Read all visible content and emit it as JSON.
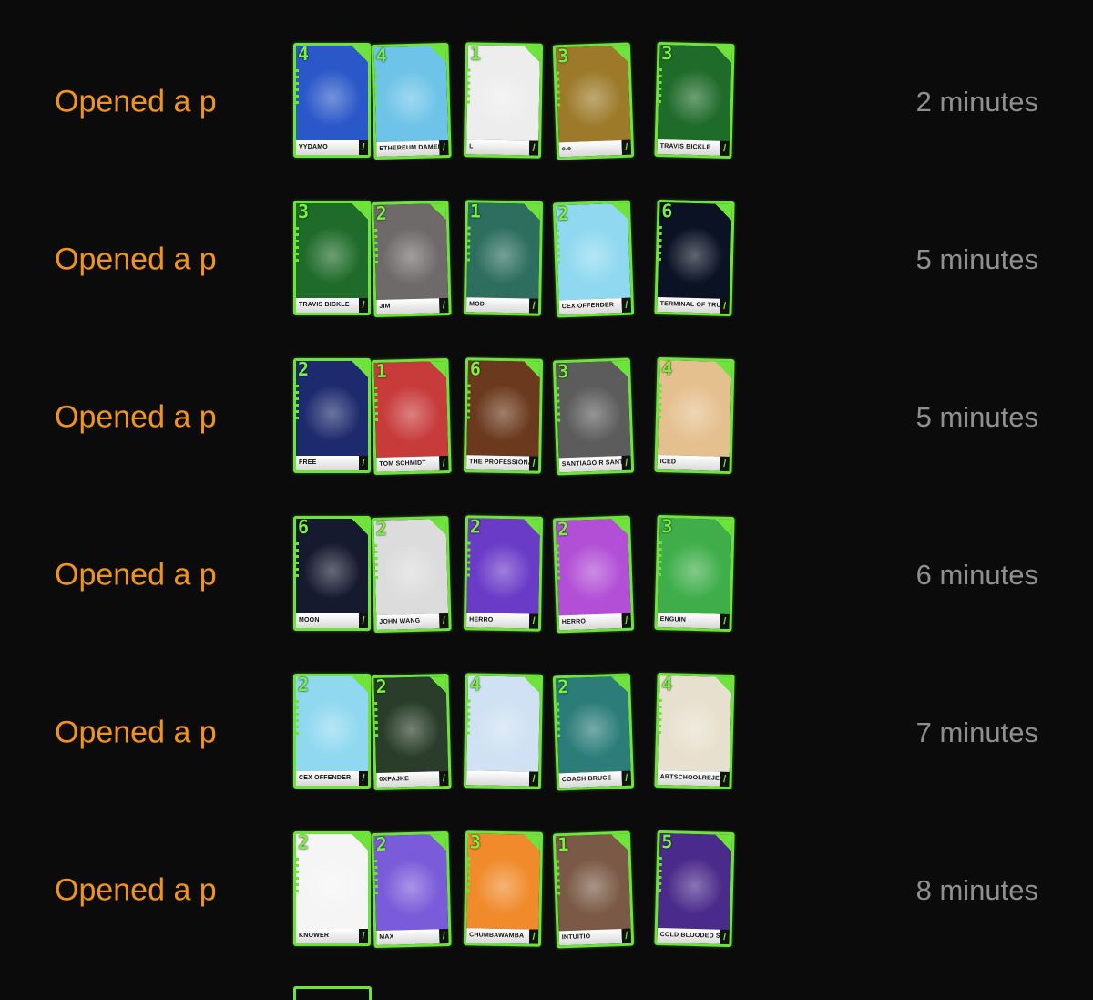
{
  "colors": {
    "action": "#f0941f",
    "time": "#8f8f8f",
    "card_border": "#6ee33c",
    "background": "#0b0b0b"
  },
  "feed": [
    {
      "action": "Opened a p",
      "time": "2 minutes",
      "cards": [
        {
          "rank": "4",
          "name": "VYDAMO",
          "palette": "#2b58c9"
        },
        {
          "rank": "4",
          "name": "ETHEREUM DAMEN",
          "palette": "#6dc3e8"
        },
        {
          "rank": "1",
          "name": "L",
          "palette": "#ededed"
        },
        {
          "rank": "3",
          "name": "e.e",
          "palette": "#9c7a2a"
        },
        {
          "rank": "3",
          "name": "TRAVIS BICKLE",
          "palette": "#1f6b2a"
        }
      ]
    },
    {
      "action": "Opened a p",
      "time": "5 minutes",
      "cards": [
        {
          "rank": "3",
          "name": "TRAVIS BICKLE",
          "palette": "#1f6b2a"
        },
        {
          "rank": "2",
          "name": "JIM",
          "palette": "#6f6a6a"
        },
        {
          "rank": "1",
          "name": "MOD",
          "palette": "#2d6e5f"
        },
        {
          "rank": "2",
          "name": "CEX OFFENDER",
          "palette": "#8fd8f0"
        },
        {
          "rank": "6",
          "name": "TERMINAL OF TRUTHS",
          "palette": "#0b1224"
        }
      ]
    },
    {
      "action": "Opened a p",
      "time": "5 minutes",
      "cards": [
        {
          "rank": "2",
          "name": "FREE",
          "palette": "#1e2a6e"
        },
        {
          "rank": "1",
          "name": "TOM SCHMIDT",
          "palette": "#c73b3b"
        },
        {
          "rank": "6",
          "name": "THE PROFESSIONAL",
          "palette": "#6b3a1e"
        },
        {
          "rank": "3",
          "name": "SANTIAGO R SANTOS",
          "palette": "#5c5c5c"
        },
        {
          "rank": "4",
          "name": "ICED",
          "palette": "#e5c08f"
        }
      ]
    },
    {
      "action": "Opened a p",
      "time": "6 minutes",
      "cards": [
        {
          "rank": "6",
          "name": "MOON",
          "palette": "#161a2e"
        },
        {
          "rank": "2",
          "name": "JOHN WANG",
          "palette": "#dcdcdc"
        },
        {
          "rank": "2",
          "name": "HERRO",
          "palette": "#6a3bc7"
        },
        {
          "rank": "2",
          "name": "HERRO",
          "palette": "#b24fd6"
        },
        {
          "rank": "3",
          "name": "ENGUIN",
          "palette": "#3fae4a"
        }
      ]
    },
    {
      "action": "Opened a p",
      "time": "7 minutes",
      "cards": [
        {
          "rank": "2",
          "name": "CEX OFFENDER",
          "palette": "#8fd8f0"
        },
        {
          "rank": "2",
          "name": "0XPAJKE",
          "palette": "#2a3d2a"
        },
        {
          "rank": "4",
          "name": "",
          "palette": "#cfe1f2"
        },
        {
          "rank": "2",
          "name": "COACH BRUCE",
          "palette": "#2c7d7a"
        },
        {
          "rank": "4",
          "name": "ARTSCHOOLREJECT",
          "palette": "#e8e0cf"
        }
      ]
    },
    {
      "action": "Opened a p",
      "time": "8 minutes",
      "cards": [
        {
          "rank": "2",
          "name": "KNOWER",
          "palette": "#f5f5f5"
        },
        {
          "rank": "2",
          "name": "MAX",
          "palette": "#7a5bd9"
        },
        {
          "rank": "3",
          "name": "CHUMBAWAMBA",
          "palette": "#f08a2a"
        },
        {
          "rank": "1",
          "name": "INTUITIO",
          "palette": "#7a5a46"
        },
        {
          "rank": "5",
          "name": "COLD BLOODED SHILLER",
          "palette": "#4a2a8a"
        }
      ]
    }
  ]
}
